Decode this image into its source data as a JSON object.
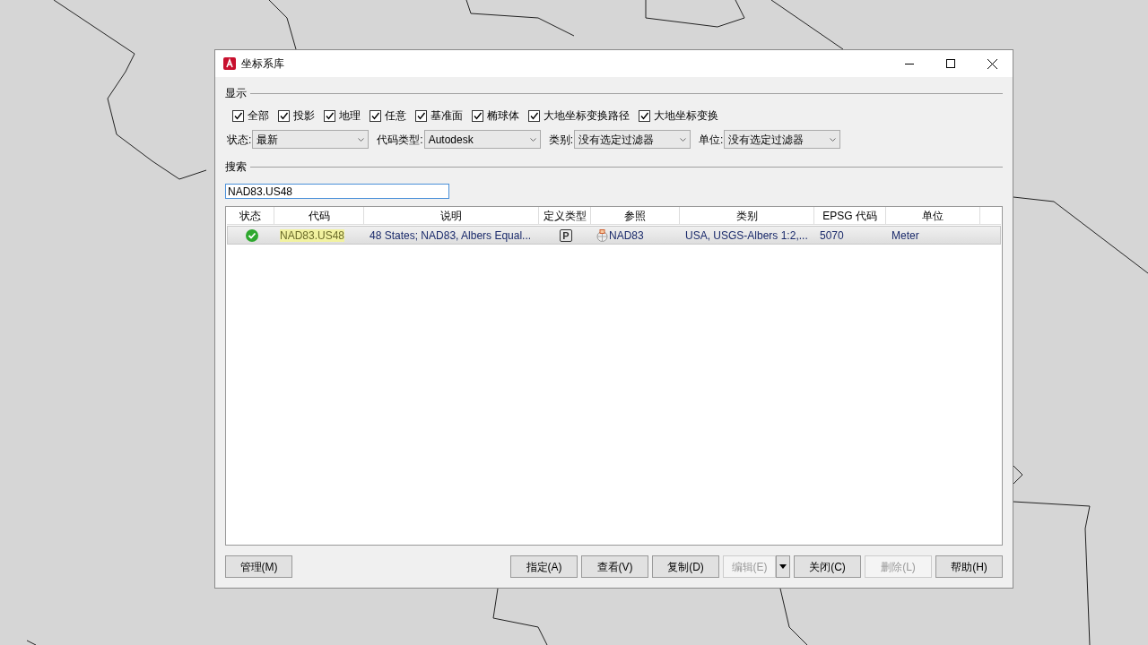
{
  "window": {
    "title": "坐标系库"
  },
  "display": {
    "label": "显示",
    "filters": [
      {
        "label": "全部",
        "checked": true
      },
      {
        "label": "投影",
        "checked": true
      },
      {
        "label": "地理",
        "checked": true
      },
      {
        "label": "任意",
        "checked": true
      },
      {
        "label": "基准面",
        "checked": true
      },
      {
        "label": "椭球体",
        "checked": true
      },
      {
        "label": "大地坐标变换路径",
        "checked": true
      },
      {
        "label": "大地坐标变换",
        "checked": true
      }
    ]
  },
  "dropdowns": [
    {
      "label": "状态:",
      "value": "最新"
    },
    {
      "label": "代码类型:",
      "value": "Autodesk"
    },
    {
      "label": "类别:",
      "value": "没有选定过滤器"
    },
    {
      "label": "单位:",
      "value": "没有选定过滤器"
    }
  ],
  "search": {
    "label": "搜索",
    "value": "NAD83.US48"
  },
  "table": {
    "columns": [
      "状态",
      "代码",
      "说明",
      "定义类型",
      "参照",
      "类别",
      "EPSG 代码",
      "单位"
    ],
    "rows": [
      {
        "selected": true,
        "valid": true,
        "code": "NAD83.US48",
        "code_matched": true,
        "description": "48 States; NAD83, Albers Equal...",
        "definition_type": "P",
        "reference": "NAD83",
        "category": "USA, USGS-Albers 1:2,...",
        "epsg": "5070",
        "unit": "Meter"
      }
    ]
  },
  "buttons_left": [
    {
      "label": "管理(M)",
      "disabled": false
    }
  ],
  "buttons_right": [
    {
      "label": "指定(A)",
      "disabled": false
    },
    {
      "label": "查看(V)",
      "disabled": false
    },
    {
      "label": "复制(D)",
      "disabled": false
    },
    {
      "label": "编辑(E)",
      "disabled": true,
      "kind": "split"
    },
    {
      "label": "关闭(C)",
      "disabled": false
    },
    {
      "label": "删除(L)",
      "disabled": true
    },
    {
      "label": "帮助(H)",
      "disabled": false
    }
  ]
}
